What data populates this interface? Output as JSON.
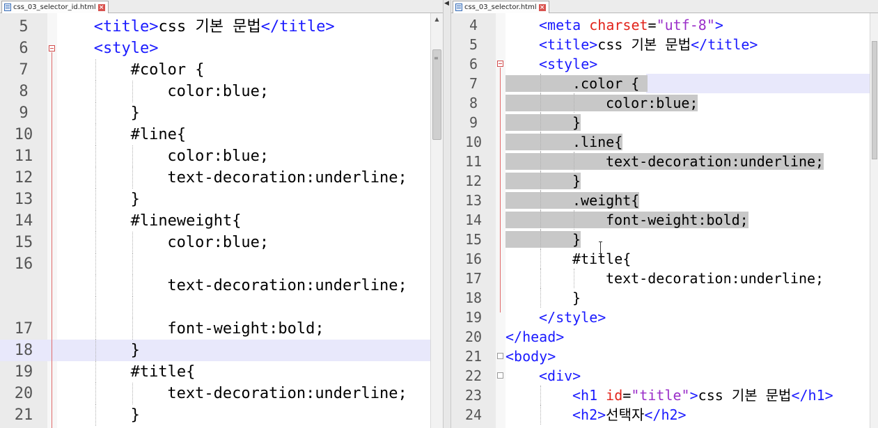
{
  "left_tab": {
    "filename": "css_03_selector_id.html"
  },
  "right_tab": {
    "filename": "css_03_selector.html"
  },
  "left_lines": [
    {
      "num": "5",
      "indent": 4,
      "parts": [
        {
          "c": "tag",
          "t": "<title>"
        },
        {
          "c": "plain",
          "t": "css 기본 문법"
        },
        {
          "c": "tag",
          "t": "</title>"
        }
      ]
    },
    {
      "num": "6",
      "indent": 4,
      "parts": [
        {
          "c": "tag",
          "t": "<style>"
        }
      ]
    },
    {
      "num": "7",
      "indent": 8,
      "parts": [
        {
          "c": "plain",
          "t": "#color {"
        }
      ]
    },
    {
      "num": "8",
      "indent": 12,
      "parts": [
        {
          "c": "plain",
          "t": "color:blue;"
        }
      ]
    },
    {
      "num": "9",
      "indent": 8,
      "parts": [
        {
          "c": "plain",
          "t": "}"
        }
      ]
    },
    {
      "num": "10",
      "indent": 8,
      "parts": [
        {
          "c": "plain",
          "t": "#line{"
        }
      ]
    },
    {
      "num": "11",
      "indent": 12,
      "parts": [
        {
          "c": "plain",
          "t": "color:blue;"
        }
      ]
    },
    {
      "num": "12",
      "indent": 12,
      "parts": [
        {
          "c": "plain",
          "t": "text-decoration:underline;"
        }
      ]
    },
    {
      "num": "13",
      "indent": 8,
      "parts": [
        {
          "c": "plain",
          "t": "}"
        }
      ]
    },
    {
      "num": "14",
      "indent": 8,
      "parts": [
        {
          "c": "plain",
          "t": "#lineweight{"
        }
      ]
    },
    {
      "num": "15",
      "indent": 12,
      "parts": [
        {
          "c": "plain",
          "t": "color:blue;"
        }
      ]
    },
    {
      "num": "16",
      "indent": 12,
      "parts": []
    },
    {
      "num": "",
      "indent": 12,
      "parts": [
        {
          "c": "plain",
          "t": "text-decoration:underline;"
        }
      ]
    },
    {
      "num": "",
      "indent": 12,
      "parts": []
    },
    {
      "num": "17",
      "indent": 12,
      "parts": [
        {
          "c": "plain",
          "t": "font-weight:bold;"
        }
      ]
    },
    {
      "num": "18",
      "indent": 8,
      "parts": [
        {
          "c": "plain",
          "t": "}"
        }
      ],
      "current": true
    },
    {
      "num": "19",
      "indent": 8,
      "parts": [
        {
          "c": "plain",
          "t": "#title{"
        }
      ]
    },
    {
      "num": "20",
      "indent": 12,
      "parts": [
        {
          "c": "plain",
          "t": "text-decoration:underline;"
        }
      ]
    },
    {
      "num": "21",
      "indent": 8,
      "parts": [
        {
          "c": "plain",
          "t": "}"
        }
      ]
    }
  ],
  "right_lines": [
    {
      "num": "4",
      "indent": 4,
      "parts": [
        {
          "c": "tag",
          "t": "<meta "
        },
        {
          "c": "attr",
          "t": "charset"
        },
        {
          "c": "plain",
          "t": "="
        },
        {
          "c": "str",
          "t": "\"utf-8\""
        },
        {
          "c": "tag",
          "t": ">"
        }
      ]
    },
    {
      "num": "5",
      "indent": 4,
      "parts": [
        {
          "c": "tag",
          "t": "<title>"
        },
        {
          "c": "plain",
          "t": "css 기본 문법"
        },
        {
          "c": "tag",
          "t": "</title>"
        }
      ]
    },
    {
      "num": "6",
      "indent": 4,
      "parts": [
        {
          "c": "tag",
          "t": "<style>"
        }
      ]
    },
    {
      "num": "7",
      "indent": 8,
      "parts": [
        {
          "c": "plain",
          "t": ".color { "
        }
      ],
      "sel": true
    },
    {
      "num": "8",
      "indent": 12,
      "parts": [
        {
          "c": "plain",
          "t": "color:blue;"
        }
      ],
      "sel": true
    },
    {
      "num": "9",
      "indent": 8,
      "parts": [
        {
          "c": "plain",
          "t": "}"
        }
      ],
      "sel": true
    },
    {
      "num": "10",
      "indent": 8,
      "parts": [
        {
          "c": "plain",
          "t": ".line{"
        }
      ],
      "sel": true
    },
    {
      "num": "11",
      "indent": 12,
      "parts": [
        {
          "c": "plain",
          "t": "text-decoration:underline;"
        }
      ],
      "sel": true
    },
    {
      "num": "12",
      "indent": 8,
      "parts": [
        {
          "c": "plain",
          "t": "}"
        }
      ],
      "sel": true
    },
    {
      "num": "13",
      "indent": 8,
      "parts": [
        {
          "c": "plain",
          "t": ".weight{"
        }
      ],
      "sel": true
    },
    {
      "num": "14",
      "indent": 12,
      "parts": [
        {
          "c": "plain",
          "t": "font-weight:bold;"
        }
      ],
      "sel": true
    },
    {
      "num": "15",
      "indent": 8,
      "parts": [
        {
          "c": "plain",
          "t": "}"
        }
      ],
      "sel": true
    },
    {
      "num": "16",
      "indent": 8,
      "parts": [
        {
          "c": "plain",
          "t": "#title{"
        }
      ]
    },
    {
      "num": "17",
      "indent": 12,
      "parts": [
        {
          "c": "plain",
          "t": "text-decoration:underline;"
        }
      ]
    },
    {
      "num": "18",
      "indent": 8,
      "parts": [
        {
          "c": "plain",
          "t": "}"
        }
      ]
    },
    {
      "num": "19",
      "indent": 4,
      "parts": [
        {
          "c": "tag",
          "t": "</style>"
        }
      ]
    },
    {
      "num": "20",
      "indent": 0,
      "parts": [
        {
          "c": "tag",
          "t": "</head>"
        }
      ]
    },
    {
      "num": "21",
      "indent": 0,
      "parts": [
        {
          "c": "tag",
          "t": "<body>"
        }
      ]
    },
    {
      "num": "22",
      "indent": 4,
      "parts": [
        {
          "c": "tag",
          "t": "<div>"
        }
      ]
    },
    {
      "num": "23",
      "indent": 8,
      "parts": [
        {
          "c": "tag",
          "t": "<h1 "
        },
        {
          "c": "attr",
          "t": "id"
        },
        {
          "c": "plain",
          "t": "="
        },
        {
          "c": "str",
          "t": "\"title\""
        },
        {
          "c": "tag",
          "t": ">"
        },
        {
          "c": "plain",
          "t": "css 기본 문법"
        },
        {
          "c": "tag",
          "t": "</h1>"
        }
      ]
    },
    {
      "num": "24",
      "indent": 8,
      "parts": [
        {
          "c": "tag",
          "t": "<h2>"
        },
        {
          "c": "plain",
          "t": "선택자"
        },
        {
          "c": "tag",
          "t": "</h2>"
        }
      ]
    }
  ]
}
